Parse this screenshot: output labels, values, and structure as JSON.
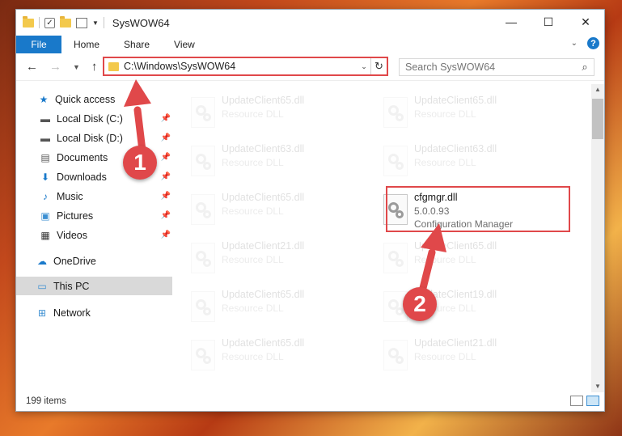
{
  "window": {
    "title": "SysWOW64",
    "minimize_icon": "minimize-icon",
    "maximize_icon": "maximize-icon",
    "close_icon": "close-icon"
  },
  "ribbon": {
    "tabs": [
      "File",
      "Home",
      "Share",
      "View"
    ],
    "help_label": "?"
  },
  "address": {
    "path": "C:\\Windows\\SysWOW64"
  },
  "search": {
    "placeholder": "Search SysWOW64"
  },
  "sidebar": {
    "items": [
      {
        "label": "Quick access",
        "icon": "star-icon",
        "pinned": false
      },
      {
        "label": "Local Disk (C:)",
        "icon": "drive-icon",
        "pinned": true
      },
      {
        "label": "Local Disk (D:)",
        "icon": "drive-icon",
        "pinned": true
      },
      {
        "label": "Documents",
        "icon": "documents-icon",
        "pinned": true
      },
      {
        "label": "Downloads",
        "icon": "download-icon",
        "pinned": true
      },
      {
        "label": "Music",
        "icon": "music-icon",
        "pinned": true
      },
      {
        "label": "Pictures",
        "icon": "pictures-icon",
        "pinned": true
      },
      {
        "label": "Videos",
        "icon": "videos-icon",
        "pinned": true
      },
      {
        "label": "OneDrive",
        "icon": "cloud-icon",
        "pinned": false
      },
      {
        "label": "This PC",
        "icon": "computer-icon",
        "pinned": false,
        "selected": true
      },
      {
        "label": "Network",
        "icon": "network-icon",
        "pinned": false
      }
    ]
  },
  "files": [
    {
      "name": "UpdateClient65.dll",
      "desc": "Resource DLL",
      "faded": true
    },
    {
      "name": "UpdateClient65.dll",
      "desc": "Resource DLL",
      "faded": true
    },
    {
      "name": "UpdateClient63.dll",
      "desc": "Resource DLL",
      "faded": true
    },
    {
      "name": "UpdateClient63.dll",
      "desc": "Resource DLL",
      "faded": true
    },
    {
      "name": "UpdateClient65.dll",
      "desc": "Resource DLL",
      "faded": true
    },
    {
      "name": "cfgmgr.dll",
      "version": "5.0.0.93",
      "desc": "Configuration Manager",
      "faded": false
    },
    {
      "name": "UpdateClient21.dll",
      "desc": "Resource DLL",
      "faded": true
    },
    {
      "name": "UpdateClient65.dll",
      "desc": "Resource DLL",
      "faded": true
    },
    {
      "name": "UpdateClient65.dll",
      "desc": "Resource DLL",
      "faded": true
    },
    {
      "name": "UpdateClient19.dll",
      "desc": "Resource DLL",
      "faded": true
    },
    {
      "name": "UpdateClient65.dll",
      "desc": "Resource DLL",
      "faded": true
    },
    {
      "name": "UpdateClient21.dll",
      "desc": "Resource DLL",
      "faded": true
    }
  ],
  "status": {
    "item_count": "199 items"
  },
  "annotations": {
    "step1": "1",
    "step2": "2",
    "color": "#e0484a"
  }
}
